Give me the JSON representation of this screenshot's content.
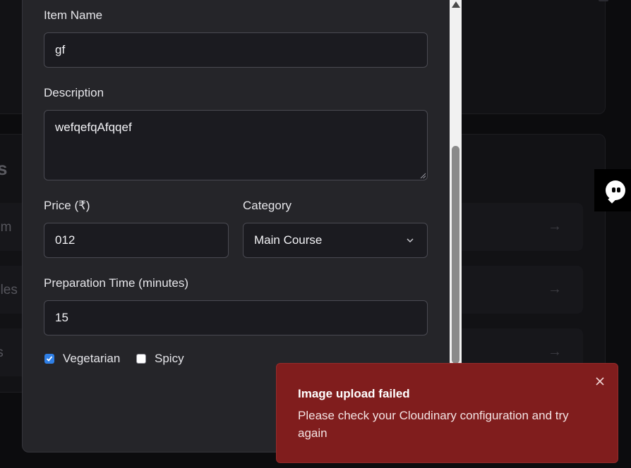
{
  "background": {
    "section_heading_fragment": "s",
    "rows": [
      {
        "label_fragment": "em",
        "arrow": "→"
      },
      {
        "label_fragment": "bles",
        "arrow": "→"
      },
      {
        "label_fragment": "ts",
        "arrow": "→"
      }
    ]
  },
  "form": {
    "item_name": {
      "label": "Item Name",
      "value": "gf"
    },
    "description": {
      "label": "Description",
      "value": "wefqefqAfqqef"
    },
    "price": {
      "label": "Price (₹)",
      "value": "012"
    },
    "category": {
      "label": "Category",
      "selected": "Main Course"
    },
    "prep_time": {
      "label": "Preparation Time (minutes)",
      "value": "15"
    },
    "vegetarian": {
      "label": "Vegetarian",
      "checked": true
    },
    "spicy": {
      "label": "Spicy",
      "checked": false
    }
  },
  "toast": {
    "title": "Image upload failed",
    "message": "Please check your Cloudinary configuration and try again",
    "background_color": "#801d1d"
  },
  "icons": {
    "close": "close-icon",
    "chevron": "chevron-down-icon",
    "check": "check-icon",
    "chat": "chat-widget-icon"
  },
  "colors": {
    "modal_bg": "#252529",
    "input_bg": "#1b1b20",
    "checkbox_accent": "#2f7fe6"
  }
}
